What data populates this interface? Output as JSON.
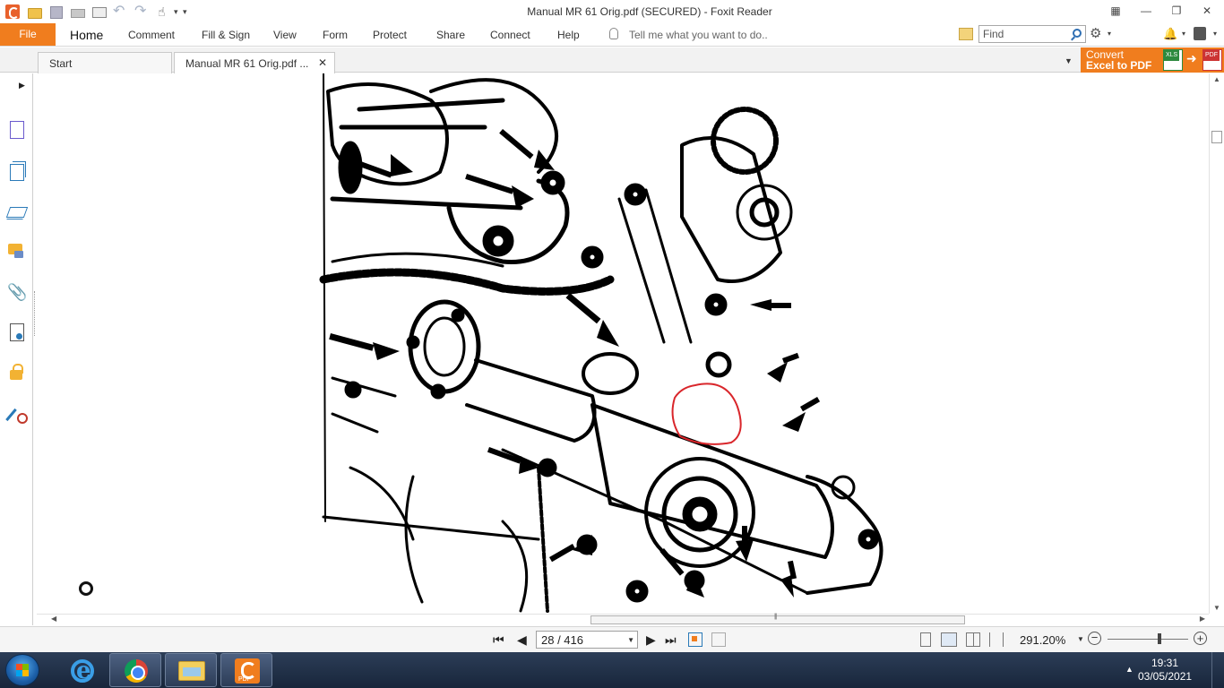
{
  "window": {
    "title": "Manual MR 61 Orig.pdf (SECURED) - Foxit Reader"
  },
  "menu": {
    "file": "File",
    "items": [
      "Home",
      "Comment",
      "Fill & Sign",
      "View",
      "Form",
      "Protect",
      "Share",
      "Connect",
      "Help"
    ],
    "tell_me_placeholder": "Tell me what you want to do..",
    "find_placeholder": "Find"
  },
  "tabs": [
    {
      "label": "Start"
    },
    {
      "label": "Manual MR 61 Orig.pdf ..."
    }
  ],
  "banner": {
    "line1": "Convert",
    "line2": "Excel to PDF"
  },
  "sidebar": {
    "icons": [
      "pages-panel-icon",
      "thumbnails-icon",
      "layers-icon",
      "comments-icon",
      "attachments-icon",
      "signatures-icon",
      "security-icon",
      "tools-icon"
    ]
  },
  "document": {
    "content": "engine-diagram-illustration",
    "annotation_color": "#d9262b"
  },
  "navigation": {
    "page_indicator": "28 / 416",
    "zoom": "291.20%"
  },
  "taskbar": {
    "apps": [
      "internet-explorer-icon",
      "chrome-icon",
      "file-explorer-icon",
      "foxit-reader-icon"
    ],
    "time": "19:31",
    "date": "03/05/2021"
  },
  "colors": {
    "accent": "#f07d1e",
    "taskbar": "#1f2f48"
  }
}
